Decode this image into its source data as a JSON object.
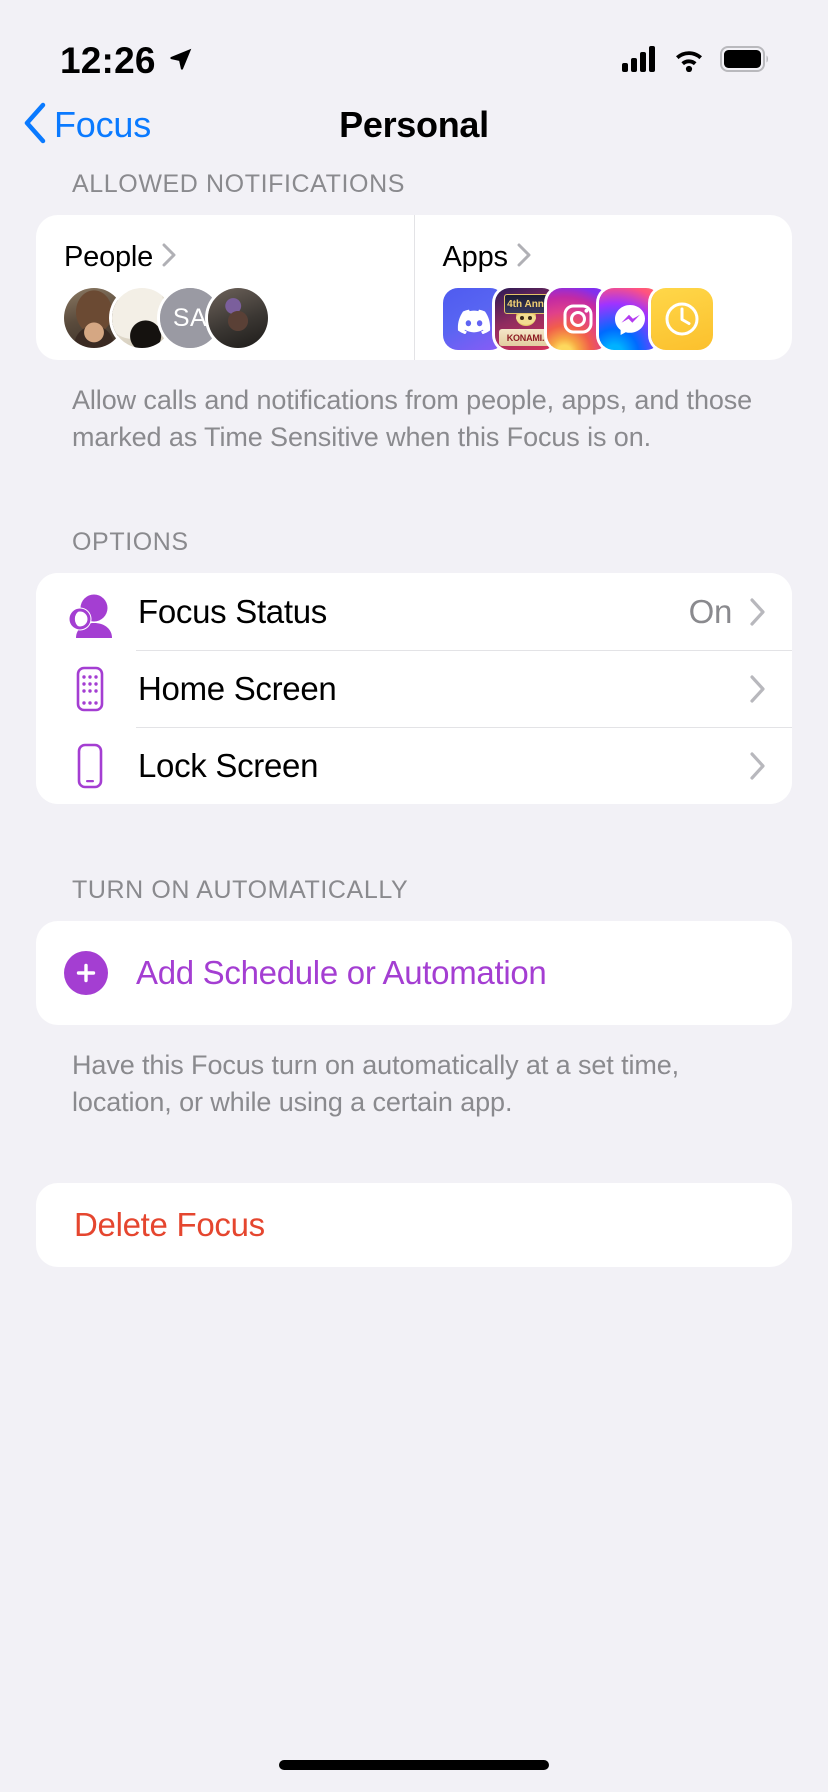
{
  "status_bar": {
    "time": "12:26",
    "location_icon": "location-arrow-icon",
    "cellular_icon": "cellular-bars-icon",
    "wifi_icon": "wifi-icon",
    "battery_icon": "battery-full-icon"
  },
  "nav": {
    "back_label": "Focus",
    "back_icon": "chevron-left-icon",
    "title": "Personal"
  },
  "allowed_notifications": {
    "header": "ALLOWED NOTIFICATIONS",
    "people": {
      "title": "People",
      "chevron_icon": "chevron-right-icon",
      "avatars": [
        {
          "type": "photo",
          "name": "avatar-person-1"
        },
        {
          "type": "photo",
          "name": "avatar-cat"
        },
        {
          "type": "initials",
          "name": "avatar-initials",
          "initials": "SA"
        },
        {
          "type": "photo",
          "name": "avatar-person-2"
        }
      ]
    },
    "apps": {
      "title": "Apps",
      "chevron_icon": "chevron-right-icon",
      "icons": [
        {
          "name": "discord-app-icon",
          "label": "Discord"
        },
        {
          "name": "duel-links-app-icon",
          "label": "Yu-Gi-Oh! Duel Links",
          "badge_top": "4th Ann",
          "badge_bottom": "KONAMI."
        },
        {
          "name": "instagram-app-icon",
          "label": "Instagram"
        },
        {
          "name": "messenger-app-icon",
          "label": "Messenger"
        },
        {
          "name": "clock-app-icon",
          "label": "Clock"
        }
      ]
    },
    "footnote": "Allow calls and notifications from people, apps, and those marked as Time Sensitive when this Focus is on."
  },
  "options": {
    "header": "OPTIONS",
    "rows": [
      {
        "label": "Focus Status",
        "value": "On",
        "icon": "focus-status-icon",
        "chevron_icon": "chevron-right-icon"
      },
      {
        "label": "Home Screen",
        "value": "",
        "icon": "home-screen-icon",
        "chevron_icon": "chevron-right-icon"
      },
      {
        "label": "Lock Screen",
        "value": "",
        "icon": "lock-screen-icon",
        "chevron_icon": "chevron-right-icon"
      }
    ]
  },
  "turn_on_automatically": {
    "header": "TURN ON AUTOMATICALLY",
    "add_label": "Add Schedule or Automation",
    "add_icon": "plus-circle-icon",
    "footnote": "Have this Focus turn on automatically at a set time, location, or while using a certain app."
  },
  "delete": {
    "label": "Delete Focus"
  },
  "colors": {
    "accent_blue": "#0a7aff",
    "purple": "#a43ed2",
    "destructive_red": "#e5462f",
    "background": "#f2f1f6",
    "card": "#ffffff",
    "secondary_text": "#8a8a8e"
  }
}
